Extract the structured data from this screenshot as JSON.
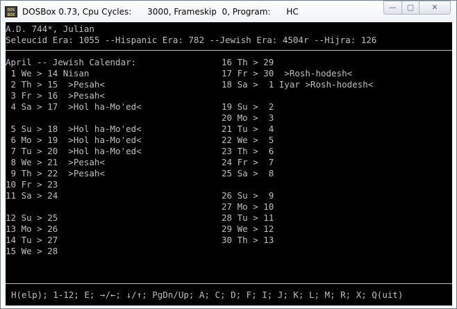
{
  "window": {
    "icon_text": "DOS BOX",
    "title": "DOSBox 0.73, Cpu Cycles:      3000, Frameskip  0, Program:      HC",
    "min_glyph": "—",
    "max_glyph": "▢",
    "close_glyph": "✕"
  },
  "header": {
    "line1": "A.D. 744*, Julian",
    "line2": "Seleucid Era: 1055 --Hispanic Era: 782 --Jewish Era: 4504r --Hijra: 126"
  },
  "calendar": {
    "title": "April -- Jewish Calendar:",
    "left": [
      " 1 We > 14 Nisan",
      " 2 Th > 15  >Pesah<",
      " 3 Fr > 16  >Pesah<",
      " 4 Sa > 17  >Hol ha-Mo'ed<",
      " 5 Su > 18  >Hol ha-Mo'ed<",
      " 6 Mo > 19  >Hol ha-Mo'ed<",
      " 7 Tu > 20  >Hol ha-Mo'ed<",
      " 8 We > 21  >Pesah<",
      " 9 Th > 22  >Pesah<",
      "10 Fr > 23",
      "11 Sa > 24",
      "12 Su > 25",
      "13 Mo > 26",
      "14 Tu > 27",
      "15 We > 28"
    ],
    "right": [
      "16 Th > 29",
      "17 Fr > 30  >Rosh-hodesh<",
      "18 Sa >  1 Iyar >Rosh-hodesh<",
      "19 Su >  2",
      "20 Mo >  3",
      "21 Tu >  4",
      "22 We >  5",
      "23 Th >  6",
      "24 Fr >  7",
      "25 Sa >  8",
      "26 Su >  9",
      "27 Mo > 10",
      "28 Tu > 11",
      "29 We > 12",
      "30 Th > 13"
    ]
  },
  "footer": {
    "commands": "H(elp); 1-12; E; →/←; ↓/↑; PgDn/Up; A; C; D; F; I; J; K; L; M; R; X; Q(uit)"
  }
}
